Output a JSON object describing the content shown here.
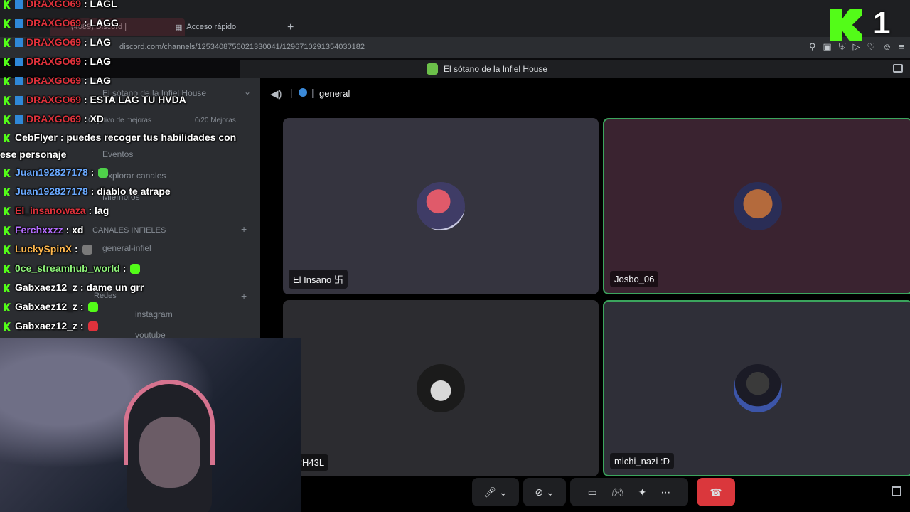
{
  "browser": {
    "tab_active": "(4089) Discord |",
    "tab_quick": "Acceso rápido",
    "url": "discord.com/channels/1253408756021330041/1296710291354030182"
  },
  "discord": {
    "server_name": "El sótano de la Infiel House",
    "sidebar": {
      "server_name": "El sótano de la Infiel House",
      "boost_goal": "Objetivo de mejoras",
      "boost_count": "0/20 Mejoras",
      "events": "Eventos",
      "browse_channels": "Explorar canales",
      "members": "Miembros",
      "category": "CANALES INFIELES",
      "channels": [
        "general-infiel",
        "Redes",
        "instagram",
        "youtube"
      ]
    },
    "voice": {
      "channel_name": "general",
      "participants": [
        {
          "name": "El Insano 卐"
        },
        {
          "name": "Josbo_06"
        },
        {
          "name": "ICH43L"
        },
        {
          "name": "michi_nazi :D"
        }
      ]
    }
  },
  "chat": [
    {
      "user": "DRAXGO69",
      "color": "#e0323c",
      "text": ": LAGL"
    },
    {
      "user": "DRAXGO69",
      "color": "#e0323c",
      "text": ": LAGG"
    },
    {
      "user": "DRAXGO69",
      "color": "#e0323c",
      "text": ": LAG"
    },
    {
      "user": "DRAXGO69",
      "color": "#e0323c",
      "text": ": LAG"
    },
    {
      "user": "DRAXGO69",
      "color": "#e0323c",
      "text": ": LAG"
    },
    {
      "user": "DRAXGO69",
      "color": "#e0323c",
      "text": ": ESTA LAG TU HVDA"
    },
    {
      "user": "DRAXGO69",
      "color": "#e0323c",
      "text": ": XD"
    },
    {
      "user": "CebFlyer",
      "color": "#ffffff",
      "text": ": puedes recoger tus habilidades con ese personaje"
    },
    {
      "user": "Juan192827178",
      "color": "#6aa9ff",
      "text": ":"
    },
    {
      "user": "Juan192827178",
      "color": "#6aa9ff",
      "text": ": diablo te atrape"
    },
    {
      "user": "El_insanowaza",
      "color": "#e0323c",
      "text": ": lag"
    },
    {
      "user": "Ferchxxzz",
      "color": "#b56cff",
      "text": ": xd"
    },
    {
      "user": "LuckySpinX",
      "color": "#ffb84d",
      "text": ":"
    },
    {
      "user": "0ce_streamhub_world",
      "color": "#8ef27a",
      "text": ":"
    },
    {
      "user": "Gabxaez12_z",
      "color": "#ffffff",
      "text": ": dame un grr"
    },
    {
      "user": "Gabxaez12_z",
      "color": "#ffffff",
      "text": ":"
    },
    {
      "user": "Gabxaez12_z",
      "color": "#ffffff",
      "text": ":"
    }
  ],
  "overlay": {
    "kick_count": "1"
  }
}
